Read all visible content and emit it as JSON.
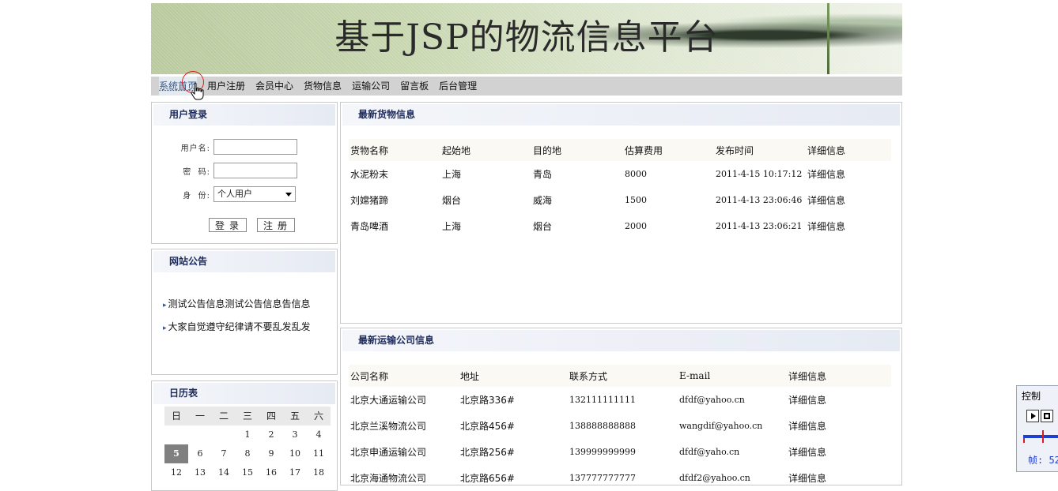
{
  "banner": {
    "title": "基于JSP的物流信息平台"
  },
  "nav": {
    "items": [
      "系统首页",
      "用户注册",
      "会员中心",
      "货物信息",
      "运输公司",
      "留言板",
      "后台管理"
    ]
  },
  "login": {
    "title": "用户登录",
    "username_label": "用户名:",
    "password_label": "密  码:",
    "role_label": "身  份:",
    "role_value": "个人用户",
    "login_button": "登录",
    "register_button": "注册"
  },
  "notice": {
    "title": "网站公告",
    "items": [
      "测试公告信息测试公告信息告信息",
      "大家自觉遵守纪律请不要乱发乱发"
    ]
  },
  "calendar": {
    "title": "日历表",
    "weekdays": [
      "日",
      "一",
      "二",
      "三",
      "四",
      "五",
      "六"
    ],
    "rows": [
      [
        "",
        "",
        "",
        "1",
        "2",
        "3",
        "4"
      ],
      [
        "5",
        "6",
        "7",
        "8",
        "9",
        "10",
        "11"
      ],
      [
        "12",
        "13",
        "14",
        "15",
        "16",
        "17",
        "18"
      ]
    ],
    "today": "5"
  },
  "goods": {
    "title": "最新货物信息",
    "headers": [
      "货物名称",
      "起始地",
      "目的地",
      "估算费用",
      "发布时间",
      "详细信息"
    ],
    "rows": [
      [
        "水泥粉末",
        "上海",
        "青岛",
        "8000",
        "2011-4-15 10:17:12",
        "详细信息"
      ],
      [
        "刘嫦猪蹄",
        "烟台",
        "威海",
        "1500",
        "2011-4-13 23:06:46",
        "详细信息"
      ],
      [
        "青岛啤酒",
        "上海",
        "烟台",
        "2000",
        "2011-4-13 23:06:21",
        "详细信息"
      ]
    ]
  },
  "transport": {
    "title": "最新运输公司信息",
    "headers": [
      "公司名称",
      "地址",
      "联系方式",
      "E-mail",
      "详细信息"
    ],
    "rows": [
      [
        "北京大通运输公司",
        "北京路336#",
        "132111111111",
        "dfdf@yahoo.cn",
        "详细信息"
      ],
      [
        "北京兰溪物流公司",
        "北京路456#",
        "138888888888",
        "wangdif@yahoo.cn",
        "详细信息"
      ],
      [
        "北京申通运输公司",
        "北京路256#",
        "139999999999",
        "dfdf@yaho.cn",
        "详细信息"
      ],
      [
        "北京海通物流公司",
        "北京路656#",
        "137777777777",
        "dfdf2@yahoo.cn",
        "详细信息"
      ]
    ]
  },
  "control": {
    "title": "控制",
    "frame_label": "帧: 52"
  }
}
